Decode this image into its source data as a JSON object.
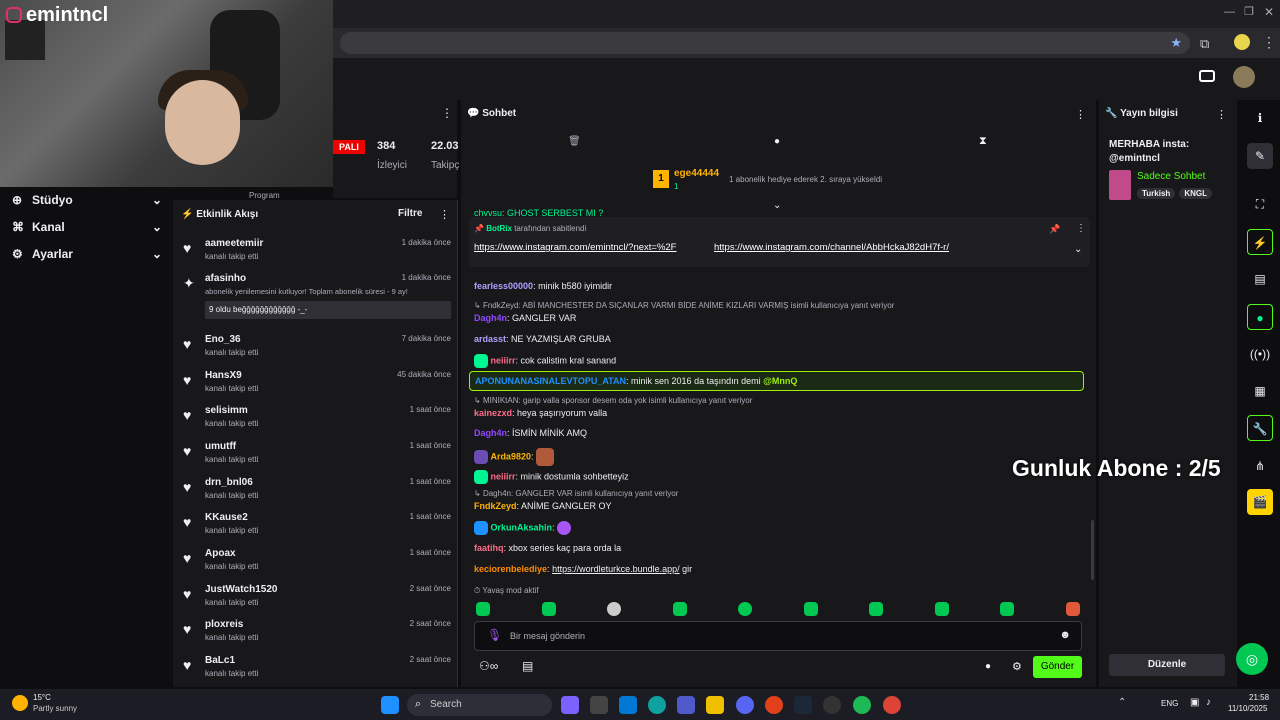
{
  "channel": {
    "handle": "emintncl"
  },
  "nav": [
    {
      "label": "Stüdyo",
      "icon": "studio-icon"
    },
    {
      "label": "Kanal",
      "icon": "channel-icon"
    },
    {
      "label": "Ayarlar",
      "icon": "settings-icon"
    }
  ],
  "stats": {
    "live_label": "PALI",
    "viewers": "384",
    "viewers_label": "İzleyici",
    "followers": "22.03",
    "followers_label": "Takipç",
    "program": "Program"
  },
  "activity": {
    "title": "Etkinlik Akışı",
    "filter": "Filtre",
    "items": [
      {
        "name": "aameetemiir",
        "sub": "kanalı takip etti",
        "time": "1 dakika önce"
      },
      {
        "name": "afasinho",
        "sub": "abonelik yenilemesini kutluyor! Toplam abonelik süresi - 9 ay!",
        "time": "1 dakika önce",
        "msg": "9 oldu beğğğğğğğğğğğğ -_-"
      },
      {
        "name": "Eno_36",
        "sub": "kanalı takip etti",
        "time": "7 dakika önce"
      },
      {
        "name": "HansX9",
        "sub": "kanalı takip etti",
        "time": "45 dakika önce"
      },
      {
        "name": "selisimm",
        "sub": "kanalı takip etti",
        "time": "1 saat önce"
      },
      {
        "name": "umutff",
        "sub": "kanalı takip etti",
        "time": "1 saat önce"
      },
      {
        "name": "drn_bnl06",
        "sub": "kanalı takip etti",
        "time": "1 saat önce"
      },
      {
        "name": "KKause2",
        "sub": "kanalı takip etti",
        "time": "1 saat önce"
      },
      {
        "name": "Apoax",
        "sub": "kanalı takip etti",
        "time": "1 saat önce"
      },
      {
        "name": "JustWatch1520",
        "sub": "kanalı takip etti",
        "time": "2 saat önce"
      },
      {
        "name": "ploxreis",
        "sub": "kanalı takip etti",
        "time": "2 saat önce"
      },
      {
        "name": "BaLc1",
        "sub": "kanalı takip etti",
        "time": "2 saat önce"
      }
    ]
  },
  "chat": {
    "title": "Sohbet",
    "hype": {
      "user": "ege44444",
      "count": "1",
      "rank": "1",
      "text": "1 abonelik hediye ederek 2. sıraya yükseldi"
    },
    "pinned": {
      "by": "BotRix",
      "by_suffix": "tarafından sabitlendi",
      "link1": "https://www.instagram.com/emintncl/?next=%2F",
      "link2": "https://www.instagram.com/channel/AbbHckaJ82dH7f-r/"
    },
    "top_partial": "chvvsu: GHOST SERBEST MI ?",
    "messages": [
      {
        "user": "fearless00000",
        "text": "minik b580 iyimidir",
        "color": "#b0a0ff"
      },
      {
        "reply": "FndkZeyd: ABİ MANCHESTER DA SIÇANLAR VARMI BİDE ANİME KIZLARI VARMIŞ isimli kullanıcıya yanıt veriyor"
      },
      {
        "user": "Dagh4n",
        "text": "GANGLER VAR",
        "color": "#9147ff"
      },
      {
        "user": "ardasst",
        "text": "NE YAZMIŞLAR GRUBA",
        "color": "#b0a0ff"
      },
      {
        "user": "neiiirr",
        "text": "cok calistim kral sanand",
        "color": "#ff6b8a"
      },
      {
        "user": "APONUNANASINALEVTOPU_ATAN",
        "text": "minik sen 2016 da taşındın demi",
        "mention": "@MnnQ",
        "color": "#1e90ff"
      },
      {
        "reply": "MINIKtAN: garip valla sponsor desem oda yok isimli kullanıcıya yanıt veriyor"
      },
      {
        "user": "kainezxd",
        "text": "heya şaşırıyorum valla",
        "color": "#ff6b8a"
      },
      {
        "user": "Dagh4n",
        "text": "İSMİN MİNİK AMQ",
        "color": "#9147ff"
      },
      {
        "user": "Arda9820",
        "text": "",
        "color": "#ffb400"
      },
      {
        "user": "neiiirr",
        "text": "minik dostumla sohbetteyiz",
        "color": "#ff6b8a"
      },
      {
        "reply": "Dagh4n: GANGLER VAR isimli kullanıcıya yanıt veriyor"
      },
      {
        "user": "FndkZeyd",
        "text": "ANİME GANGLER OY",
        "color": "#ffb400"
      },
      {
        "user": "OrkunAksahin",
        "text": "",
        "color": "#00f593"
      },
      {
        "user": "faatihq",
        "text": "xbox series kaç para orda la",
        "color": "#ff6b8a"
      },
      {
        "user": "keciorenbelediye",
        "text": "gir",
        "link": "https://wordleturkce.bundle.app/",
        "color": "#ff8c00"
      }
    ],
    "slow_mode": "Yavaş mod aktif",
    "input_placeholder": "Bir mesaj gönderin",
    "send": "Gönder"
  },
  "info": {
    "title": "Yayın bilgisi",
    "stream_title": "MERHABA insta: @emintncl",
    "category": "Sadece Sohbet",
    "tags": [
      "Turkish",
      "KNGL"
    ],
    "edit": "Düzenle"
  },
  "overlay": {
    "sub_goal": "Gunluk Abone : 2/5"
  },
  "taskbar": {
    "weather_temp": "15°C",
    "weather_desc": "Partly sunny",
    "search": "Search",
    "lang": "ENG",
    "time": "21:58",
    "date": "11/10/2025"
  }
}
